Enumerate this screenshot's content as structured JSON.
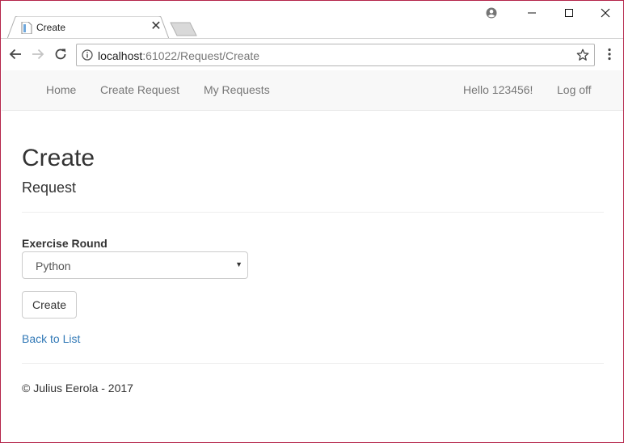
{
  "browser": {
    "tab_title": "Create",
    "tab_close": "✕",
    "url_host": "localhost",
    "url_rest": ":61022/Request/Create",
    "icons": [
      "page-favicon-icon",
      "profile-icon",
      "minimize-icon",
      "maximize-icon",
      "close-icon",
      "back-arrow-icon",
      "forward-arrow-icon",
      "reload-icon",
      "info-icon",
      "star-icon",
      "menu-icon"
    ]
  },
  "navbar": {
    "links": [
      "Home",
      "Create Request",
      "My Requests"
    ],
    "greeting": "Hello 123456!",
    "logoff": "Log off"
  },
  "page": {
    "title": "Create",
    "subtitle": "Request",
    "field_label": "Exercise Round",
    "select_value": "Python",
    "create_button": "Create",
    "back_link": "Back to List",
    "footer": "© Julius Eerola - 2017"
  },
  "colors": {
    "link": "#337ab7",
    "navbar_bg": "#f8f8f8",
    "window_border": "#b4244a"
  }
}
